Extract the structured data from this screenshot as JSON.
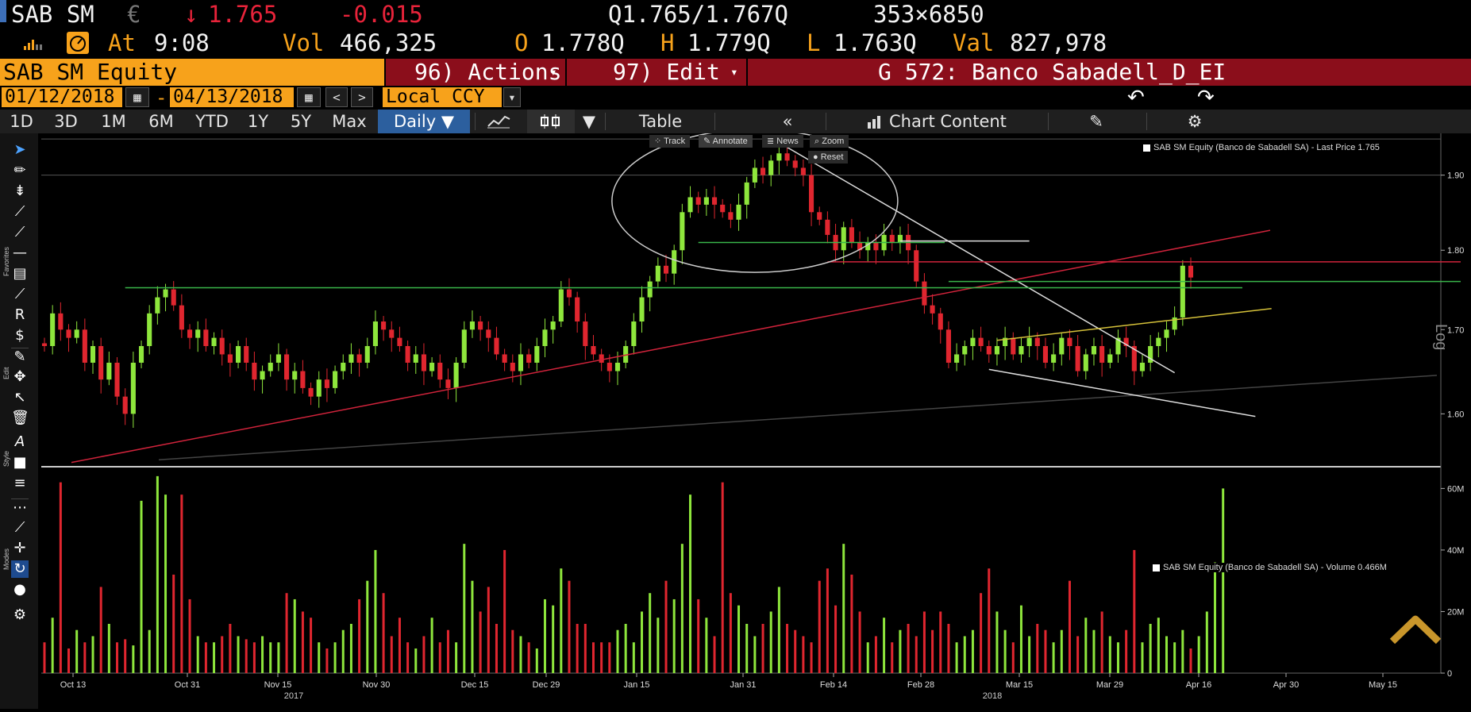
{
  "ticker": {
    "name": "SAB SM",
    "currency_symbol": "€",
    "arrow": "↓",
    "last": "1.765",
    "change": "-0.015",
    "quote": "Q1.765/1.767Q",
    "size": "353×6850"
  },
  "stats": {
    "at_label": "At",
    "time": "9:08",
    "vol_label": "Vol",
    "vol": "466,325",
    "open_label": "O",
    "open": "1.778Q",
    "high_label": "H",
    "high": "1.779Q",
    "low_label": "L",
    "low": "1.763Q",
    "val_label": "Val",
    "val": "827,978"
  },
  "header": {
    "security": "SAB SM Equity",
    "actions": "96) Actions",
    "edit": "97) Edit",
    "chart_id": "G 572: Banco Sabadell_D_EI"
  },
  "range": {
    "start": "01/12/2018",
    "dash": "-",
    "end": "04/13/2018",
    "currency": "Local CCY",
    "prev": "<",
    "next": ">"
  },
  "tabs": [
    "1D",
    "3D",
    "1M",
    "6M",
    "YTD",
    "1Y",
    "5Y",
    "Max"
  ],
  "periodicity": "Daily ▼",
  "table_label": "Table",
  "chart_content_label": "Chart Content",
  "chart_modes": {
    "track": "Track",
    "annotate": "Annotate",
    "news": "News",
    "zoom": "Zoom",
    "reset": "Reset"
  },
  "side_labels": {
    "favorites": "Favorites",
    "edit": "Edit",
    "style": "Style",
    "modes": "Modes"
  },
  "scale_label": "Log",
  "colors": {
    "up": "#8ee63c",
    "down": "#e0262f",
    "accent": "#f7a21b",
    "banner_red": "#8b0e1b",
    "active_tab": "#2c5f9e"
  },
  "chart_data": [
    {
      "type": "candlestick",
      "legend": "SAB SM Equity (Banco de Sabadell SA) - Last Price 1.765",
      "scale": "log",
      "y_ticks": [
        "1.90",
        "1.80",
        "1.70",
        "1.60"
      ],
      "x_ticks": [
        "Oct 13",
        "Oct 31",
        "Nov 15",
        "Nov 30",
        "Dec 15",
        "Dec 29",
        "Jan 15",
        "Jan 31",
        "Feb 14",
        "Feb 28",
        "Mar 15",
        "Mar 29",
        "Apr 16",
        "Apr 30",
        "May 15"
      ],
      "year_labels": [
        "2017",
        "2018"
      ],
      "last_price": 1.765,
      "closes": [
        1.68,
        1.72,
        1.7,
        1.69,
        1.7,
        1.66,
        1.68,
        1.64,
        1.66,
        1.62,
        1.6,
        1.66,
        1.68,
        1.72,
        1.74,
        1.75,
        1.73,
        1.7,
        1.69,
        1.7,
        1.68,
        1.69,
        1.67,
        1.66,
        1.68,
        1.66,
        1.64,
        1.65,
        1.66,
        1.67,
        1.64,
        1.65,
        1.63,
        1.62,
        1.64,
        1.63,
        1.65,
        1.66,
        1.67,
        1.66,
        1.68,
        1.71,
        1.7,
        1.69,
        1.68,
        1.66,
        1.67,
        1.65,
        1.66,
        1.64,
        1.63,
        1.66,
        1.7,
        1.71,
        1.7,
        1.69,
        1.67,
        1.66,
        1.65,
        1.67,
        1.66,
        1.68,
        1.7,
        1.71,
        1.75,
        1.74,
        1.71,
        1.68,
        1.67,
        1.66,
        1.65,
        1.66,
        1.68,
        1.71,
        1.74,
        1.76,
        1.78,
        1.77,
        1.8,
        1.85,
        1.87,
        1.86,
        1.87,
        1.86,
        1.85,
        1.84,
        1.86,
        1.89,
        1.91,
        1.9,
        1.92,
        1.93,
        1.92,
        1.91,
        1.9,
        1.85,
        1.84,
        1.82,
        1.8,
        1.83,
        1.81,
        1.8,
        1.81,
        1.8,
        1.82,
        1.81,
        1.82,
        1.8,
        1.76,
        1.73,
        1.72,
        1.7,
        1.66,
        1.67,
        1.68,
        1.69,
        1.68,
        1.67,
        1.68,
        1.69,
        1.67,
        1.68,
        1.69,
        1.68,
        1.66,
        1.67,
        1.69,
        1.68,
        1.65,
        1.67,
        1.68,
        1.66,
        1.67,
        1.69,
        1.68,
        1.65,
        1.66,
        1.68,
        1.69,
        1.7,
        1.715,
        1.78,
        1.765
      ],
      "support_levels": [
        1.752,
        1.785,
        1.81
      ]
    },
    {
      "type": "bar",
      "legend": "SAB SM Equity (Banco de Sabadell SA) - Volume 0.466M",
      "y_ticks": [
        "60M",
        "40M",
        "20M",
        "0"
      ],
      "unit": "M",
      "values": [
        10,
        18,
        62,
        8,
        14,
        10,
        12,
        28,
        16,
        10,
        11,
        9,
        56,
        14,
        64,
        58,
        32,
        58,
        24,
        12,
        10,
        10,
        12,
        16,
        12,
        11,
        10,
        12,
        10,
        10,
        26,
        24,
        20,
        18,
        10,
        8,
        10,
        14,
        16,
        24,
        30,
        40,
        26,
        12,
        18,
        10,
        8,
        12,
        18,
        10,
        14,
        10,
        42,
        30,
        20,
        28,
        16,
        40,
        14,
        12,
        10,
        8,
        24,
        22,
        34,
        30,
        16,
        16,
        10,
        10,
        10,
        14,
        16,
        10,
        20,
        26,
        18,
        30,
        24,
        42,
        58,
        24,
        18,
        12,
        62,
        26,
        22,
        16,
        12,
        16,
        20,
        28,
        16,
        14,
        12,
        10,
        30,
        34,
        22,
        42,
        32,
        20,
        10,
        12,
        18,
        10,
        14,
        16,
        12,
        20,
        14,
        20,
        16,
        10,
        12,
        14,
        26,
        34,
        20,
        14,
        10,
        22,
        12,
        16,
        14,
        10,
        14,
        30,
        12,
        18,
        14,
        20,
        12,
        10,
        14,
        40,
        10,
        16,
        18,
        12,
        10,
        14,
        8,
        12,
        20,
        36,
        60
      ]
    }
  ]
}
